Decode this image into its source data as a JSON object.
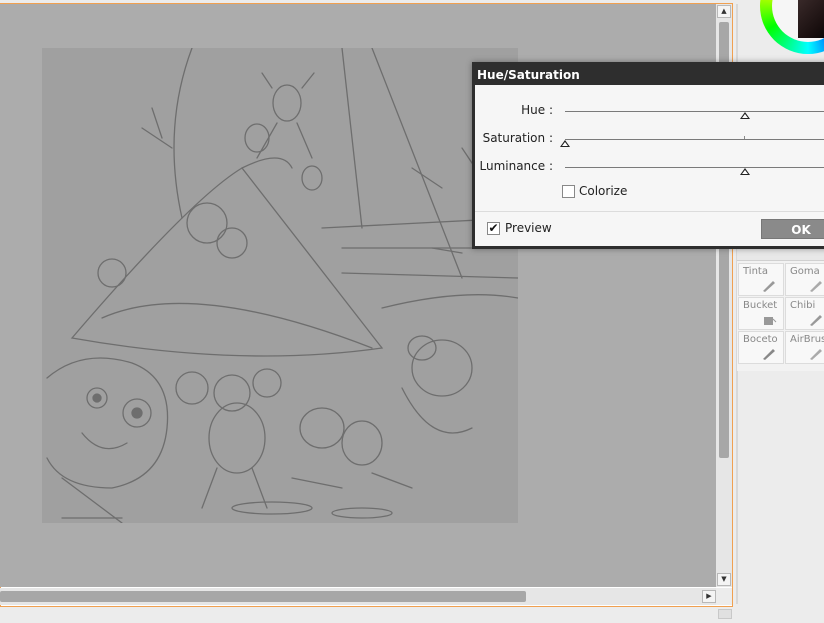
{
  "dialog": {
    "title": "Hue/Saturation",
    "hue_label": "Hue :",
    "saturation_label": "Saturation :",
    "luminance_label": "Luminance :",
    "colorize_label": "Colorize",
    "colorize_checked": false,
    "preview_label": "Preview",
    "preview_checked": true,
    "ok_label": "OK",
    "preview_check_glyph": "✔"
  },
  "tool_panel": {
    "tools": [
      {
        "label": "Tinta",
        "icon": "pen-icon"
      },
      {
        "label": "Goma",
        "icon": "eraser-icon"
      },
      {
        "label": "Bucket",
        "icon": "bucket-icon"
      },
      {
        "label": "Chibi",
        "icon": "pen-icon"
      },
      {
        "label": "Boceto",
        "icon": "pencil-icon"
      },
      {
        "label": "AirBrush",
        "icon": "airbrush-icon"
      }
    ]
  },
  "scrollbars": {
    "up_arrow": "▲",
    "down_arrow": "▼",
    "right_arrow": "▶"
  },
  "colors": {
    "canvas_background": "#acacac",
    "artwork_background": "#a0a0a0",
    "sketch_stroke": "#6e6e6e",
    "dialog_titlebar": "#2e2e2e",
    "ok_button": "#8a8a8a",
    "frame_accent": "#f0a050"
  }
}
